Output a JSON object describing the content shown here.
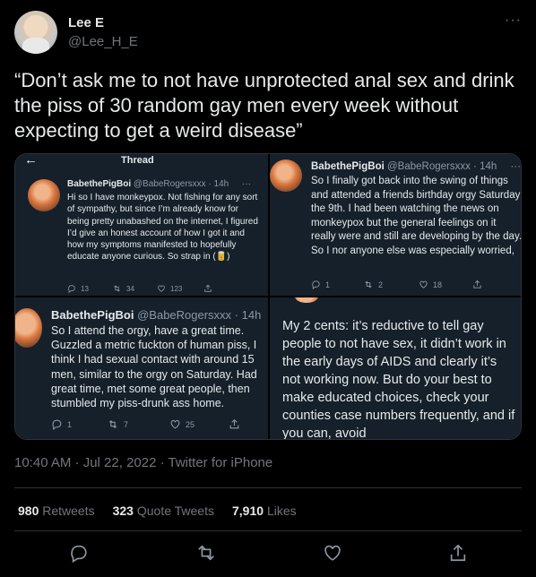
{
  "author": {
    "name": "Lee E",
    "handle": "@Lee_H_E",
    "more_icon": "ellipsis-icon"
  },
  "tweet": {
    "text": "“Don’t ask me to not have unprotected anal sex and drink the piss of 30 random gay men every week without expecting to get a weird disease”"
  },
  "media": {
    "pane1": {
      "header_title": "Thread",
      "name": "BabethePigBoi",
      "handle": "@BabeRogersxxx · 14h",
      "more": "···",
      "text": "Hi so I have monkeypox. Not fishing for any sort of sympathy, but since I’m already know for being pretty unabashed on the internet, I figured I’d give an honest account of how I got it and how my symptoms manifested to hopefully educate anyone curious. So strap in (🥫)",
      "replies": "13",
      "retweets": "34",
      "likes": "123"
    },
    "pane2": {
      "name": "BabethePigBoi",
      "handle": "@BabeRogersxxx · 14h",
      "more": "···",
      "text": "So I finally got back into the swing of things and attended a friends birthday orgy Saturday the 9th. I had been watching the news on monkeypox but the general feelings on it really were and still are developing by the day. So I nor anyone else was especially worried,",
      "replies": "1",
      "retweets": "2",
      "likes": "18"
    },
    "pane3": {
      "name": "BabethePigBoi",
      "handle": "@BabeRogersxxx · 14h",
      "text": "So I attend the orgy, have a great time. Guzzled a metric fuckton of human piss, I think I had sexual contact with around 15 men, similar to the orgy on Saturday. Had great time, met some great people, then stumbled my piss-drunk ass home.",
      "replies": "1",
      "retweets": "7",
      "likes": "25"
    },
    "pane4": {
      "text": "My 2 cents: it’s reductive to tell gay people to not have sex, it didn’t work in the early days of AIDS and clearly it’s not working now. But do your best to make educated choices, check your counties case numbers frequently, and if you can, avoid"
    }
  },
  "timestamp": "10:40 AM · Jul 22, 2022 · Twitter for iPhone",
  "stats": {
    "retweets_count": "980",
    "retweets_label": "Retweets",
    "quotes_count": "323",
    "quotes_label": "Quote Tweets",
    "likes_count": "7,910",
    "likes_label": "Likes"
  },
  "actions": [
    "reply-icon",
    "retweet-icon",
    "like-icon",
    "share-icon"
  ],
  "colors": {
    "background": "#000000",
    "dim_background": "#15202b",
    "text": "#e7e9ea",
    "secondary": "#71767b",
    "border": "#2f3336"
  }
}
